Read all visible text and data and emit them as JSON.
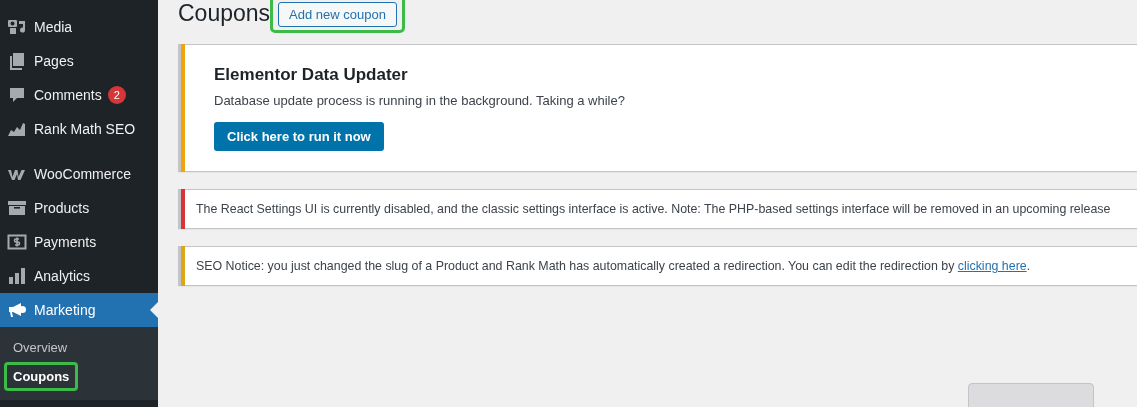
{
  "sidebar": {
    "groups": [
      {
        "items": [
          {
            "label": "Media",
            "kind": "media",
            "selected": false
          },
          {
            "label": "Pages",
            "kind": "pages",
            "selected": false
          },
          {
            "label": "Comments",
            "kind": "comments",
            "selected": false,
            "badge": "2"
          },
          {
            "label": "Rank Math SEO",
            "kind": "rankmath",
            "selected": false
          }
        ]
      },
      {
        "items": [
          {
            "label": "WooCommerce",
            "kind": "woo",
            "selected": false
          },
          {
            "label": "Products",
            "kind": "products",
            "selected": false
          },
          {
            "label": "Payments",
            "kind": "payments",
            "selected": false
          },
          {
            "label": "Analytics",
            "kind": "analytics",
            "selected": false
          },
          {
            "label": "Marketing",
            "kind": "marketing",
            "selected": true,
            "children": [
              {
                "label": "Overview",
                "selected": false,
                "highlighted": false
              },
              {
                "label": "Coupons",
                "selected": true,
                "highlighted": true
              }
            ]
          }
        ]
      }
    ]
  },
  "page": {
    "title": "Coupons",
    "action": {
      "label": "Add new coupon",
      "highlighted": true
    }
  },
  "notices": [
    {
      "kind": "elementor",
      "color": "#f0a30a",
      "title": "Elementor Data Updater",
      "text": "Database update process is running in the background. Taking a while?",
      "button": "Click here to run it now"
    },
    {
      "kind": "plain",
      "color": "#d63638",
      "text": "The React Settings UI is currently disabled, and the classic settings interface is active. Note: The PHP-based settings interface will be removed in an upcoming release"
    },
    {
      "kind": "plain",
      "color": "#dba617",
      "text": "SEO Notice: you just changed the slug of a Product and Rank Math has automatically created a redirection. You can edit the redirection by ",
      "link": "clicking here",
      "after": "."
    }
  ]
}
